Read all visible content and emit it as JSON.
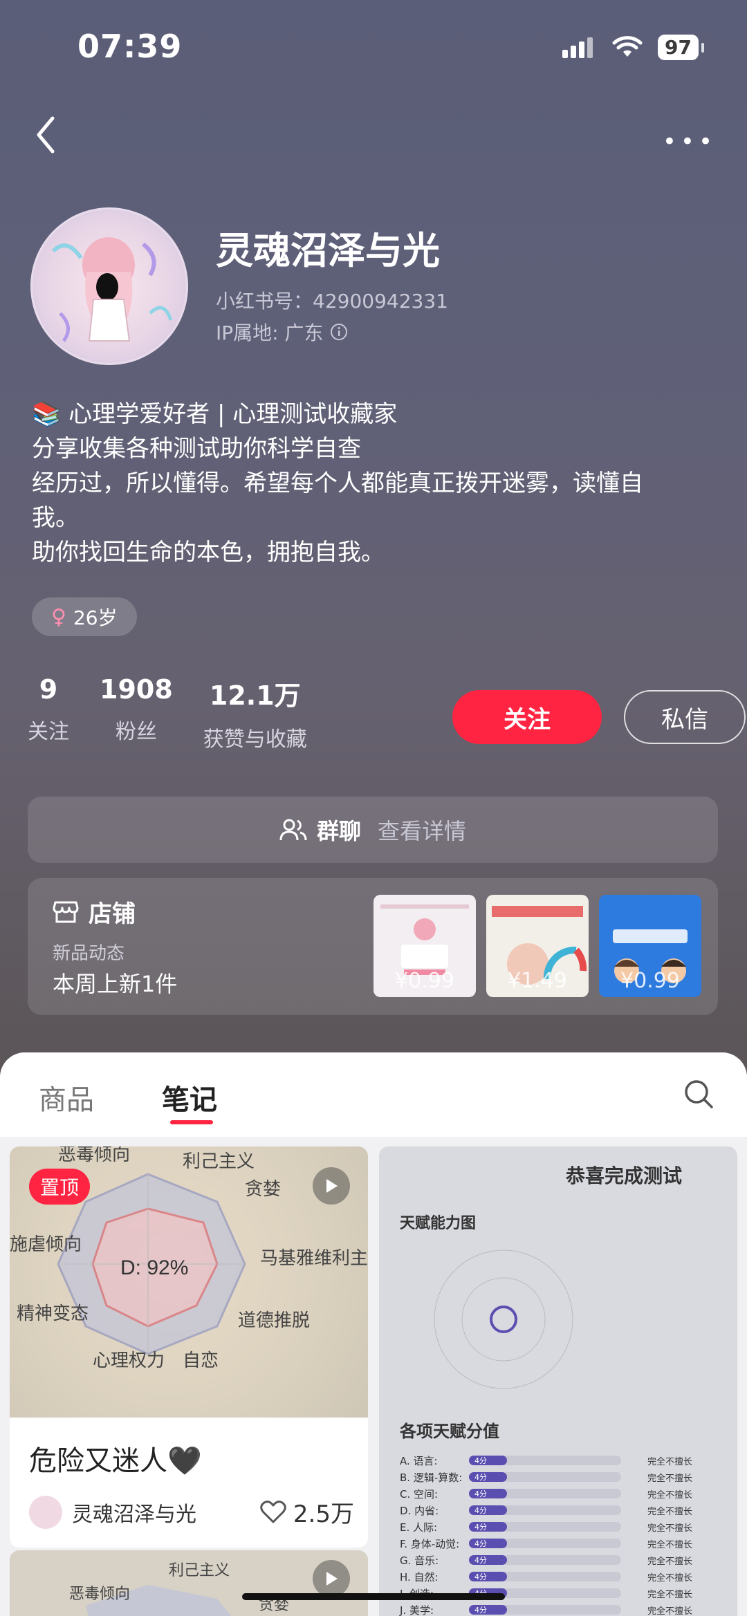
{
  "status": {
    "time": "07:39",
    "battery": "97"
  },
  "profile": {
    "name": "灵魂沼泽与光",
    "red_id": "小红书号：42900942331",
    "ip": "IP属地: 广东",
    "bio": [
      "📚 心理学爱好者 | 心理测试收藏家",
      "分享收集各种测试助你科学自查",
      "经历过，所以懂得。希望每个人都能真正拨开迷雾，读懂自",
      "我。",
      "助你找回生命的本色，拥抱自我。"
    ],
    "tag": "26岁"
  },
  "stats": [
    {
      "value": "9",
      "label": "关注"
    },
    {
      "value": "1908",
      "label": "粉丝"
    },
    {
      "value": "12.1万",
      "label": "获赞与收藏"
    }
  ],
  "buttons": {
    "follow": "关注",
    "message": "私信"
  },
  "group": {
    "title": "群聊",
    "sub": "查看详情"
  },
  "shop": {
    "title": "店铺",
    "sub": "新品动态",
    "new": "本周上新1件",
    "items": [
      {
        "price": "¥0.99",
        "color": "#f3eef1"
      },
      {
        "price": "¥1.49",
        "color": "#f2efe9"
      },
      {
        "price": "¥0.99",
        "color": "#2e7be0"
      }
    ]
  },
  "tabs": {
    "products": "商品",
    "notes": "笔记"
  },
  "notes": [
    {
      "badge": "置顶",
      "title": "危险又迷人🖤",
      "author": "灵魂沼泽与光",
      "likes": "2.5万",
      "radar_labels": [
        "利己主义",
        "贪婪",
        "马基雅维利主义",
        "道德推脱",
        "自恋",
        "心理权力",
        "精神变态",
        "施虐倾向",
        "恶毒倾向"
      ],
      "center_text": "D: 92%"
    },
    {
      "title": "恭喜完成测试",
      "subtitle": "天赋能力图",
      "section": "各项天赋分值",
      "rows": [
        "A. 语言:",
        "B. 逻辑-算数:",
        "C. 空间:",
        "D. 内省:",
        "E. 人际:",
        "F. 身体-动觉:",
        "G. 音乐:",
        "H. 自然:",
        "I. 创造:",
        "J. 美学:"
      ],
      "score": "4分",
      "verdict": "完全不擅长"
    },
    {
      "labels": [
        "利己主义",
        "恶毒倾向",
        "贪婪"
      ]
    }
  ]
}
